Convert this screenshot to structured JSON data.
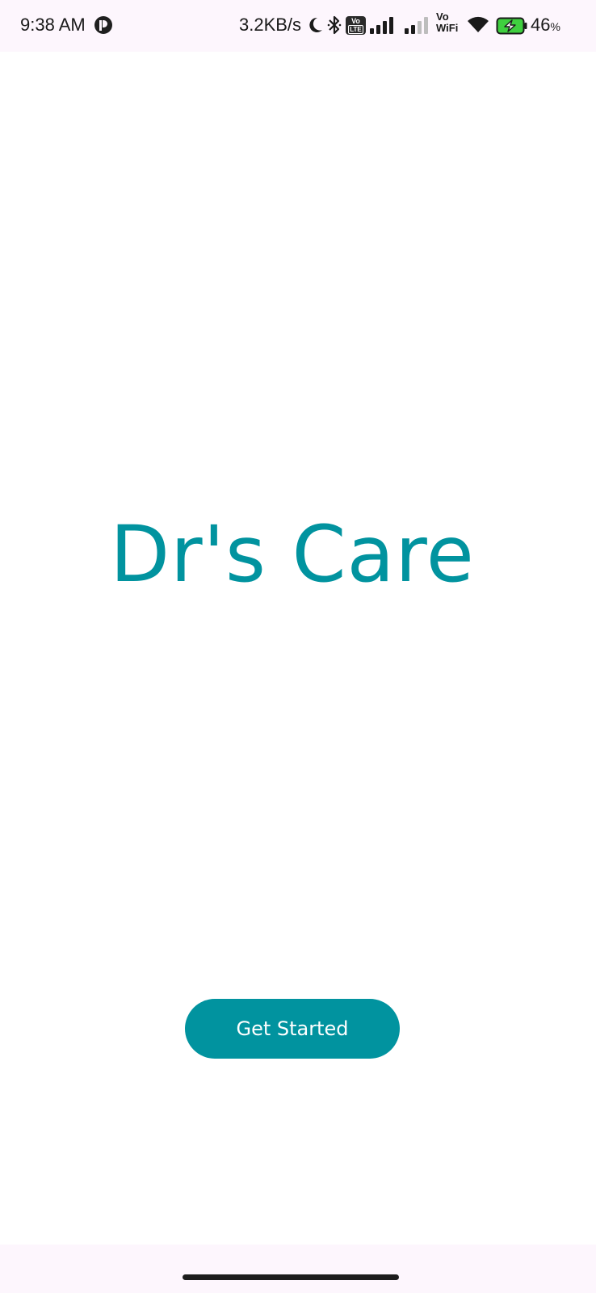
{
  "status_bar": {
    "time": "9:38 AM",
    "net_speed": "3.2KB/s",
    "volte_label_top": "Vo",
    "volte_label_bottom": "LTE",
    "vowifi_top": "Vo",
    "vowifi_bottom": "WiFi",
    "battery_level": "46",
    "battery_unit": "%",
    "icons": [
      "app-notification-icon",
      "do-not-disturb-moon-icon",
      "bluetooth-icon",
      "volte-icon",
      "cellular-signal-icon",
      "cellular-signal-icon",
      "vowifi-icon",
      "wifi-icon",
      "battery-charging-icon"
    ]
  },
  "main": {
    "title": "Dr's Care",
    "get_started_label": "Get Started"
  },
  "colors": {
    "accent": "#01939f",
    "status_bar_bg": "#fdf6fd",
    "background": "#ffffff"
  }
}
